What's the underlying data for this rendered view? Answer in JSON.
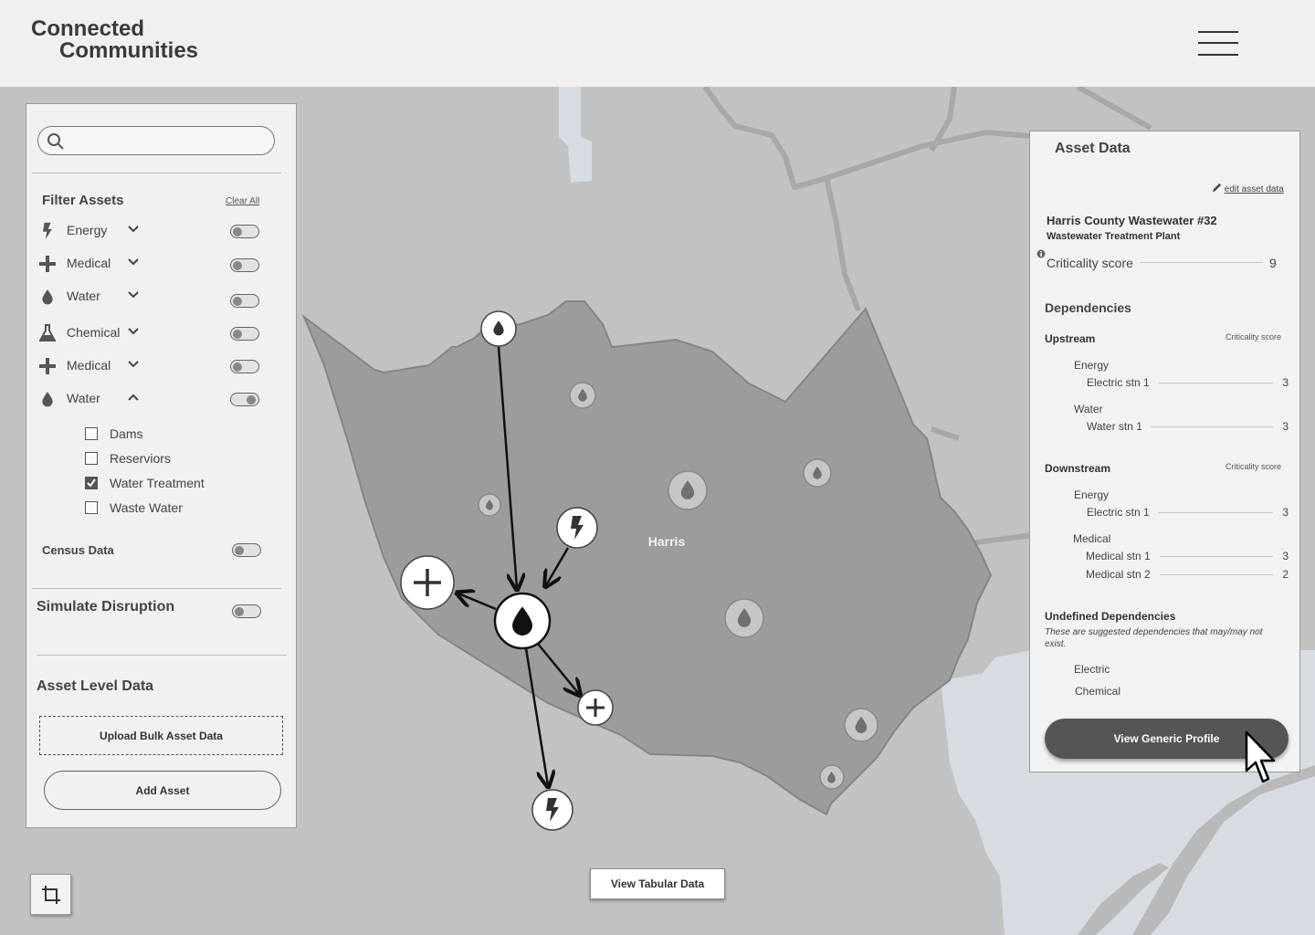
{
  "header": {
    "logo_line1": "Connected",
    "logo_line2": "Communities"
  },
  "search": {
    "placeholder": ""
  },
  "filter": {
    "title": "Filter Assets",
    "clear_all": "Clear All",
    "categories": [
      {
        "label": "Energy",
        "icon": "lightning-icon",
        "expanded": false,
        "on": false
      },
      {
        "label": "Medical",
        "icon": "cross-icon",
        "expanded": false,
        "on": false
      },
      {
        "label": "Water",
        "icon": "water-drop-icon",
        "expanded": false,
        "on": false
      },
      {
        "label": "Chemical",
        "icon": "flask-icon",
        "expanded": false,
        "on": false
      },
      {
        "label": "Medical",
        "icon": "cross-icon",
        "expanded": false,
        "on": false
      },
      {
        "label": "Water",
        "icon": "water-drop-icon",
        "expanded": true,
        "on": true
      }
    ],
    "water_subtypes": [
      {
        "label": "Dams",
        "checked": false
      },
      {
        "label": "Reserviors",
        "checked": false
      },
      {
        "label": "Water Treatment",
        "checked": true
      },
      {
        "label": "Waste Water",
        "checked": false
      }
    ],
    "census_label": "Census Data"
  },
  "simulate": {
    "label": "Simulate Disruption"
  },
  "asset_level": {
    "title": "Asset Level Data",
    "upload_label": "Upload Bulk Asset Data",
    "add_label": "Add Asset"
  },
  "map": {
    "region_label": "Harris",
    "tabular_button": "View Tabular Data"
  },
  "asset_panel": {
    "title": "Asset Data",
    "edit_link": "edit asset data",
    "asset_name": "Harris County Wastewater #32",
    "asset_type": "Wastewater Treatment Plant",
    "criticality_label": "Criticality score",
    "criticality_value": "9",
    "dependencies_title": "Dependencies",
    "upstream": {
      "title": "Upstream",
      "score_header": "Criticality score",
      "groups": [
        {
          "category": "Energy",
          "items": [
            {
              "name": "Electric stn 1",
              "score": "3"
            }
          ]
        },
        {
          "category": "Water",
          "items": [
            {
              "name": "Water stn 1",
              "score": "3"
            }
          ]
        }
      ]
    },
    "downstream": {
      "title": "Downstream",
      "score_header": "Criticality score",
      "groups": [
        {
          "category": "Energy",
          "items": [
            {
              "name": "Electric stn 1",
              "score": "3"
            }
          ]
        },
        {
          "category": "Medical",
          "items": [
            {
              "name": "Medical stn 1",
              "score": "3"
            },
            {
              "name": "Medical stn 2",
              "score": "2"
            }
          ]
        }
      ]
    },
    "undefined": {
      "title": "Undefined Dependencies",
      "note": "These are suggested dependencies that may/may not exist.",
      "items": [
        "Electric",
        "Chemical"
      ]
    },
    "view_profile_button": "View Generic Profile"
  },
  "colors": {
    "header_bg": "#f0f0f0",
    "map_bg": "#c3c2c2",
    "region_fill": "#9c9c9c",
    "water_body": "#d7dce2",
    "panel_bg": "#f2f2f2",
    "button_dark": "#555555"
  }
}
